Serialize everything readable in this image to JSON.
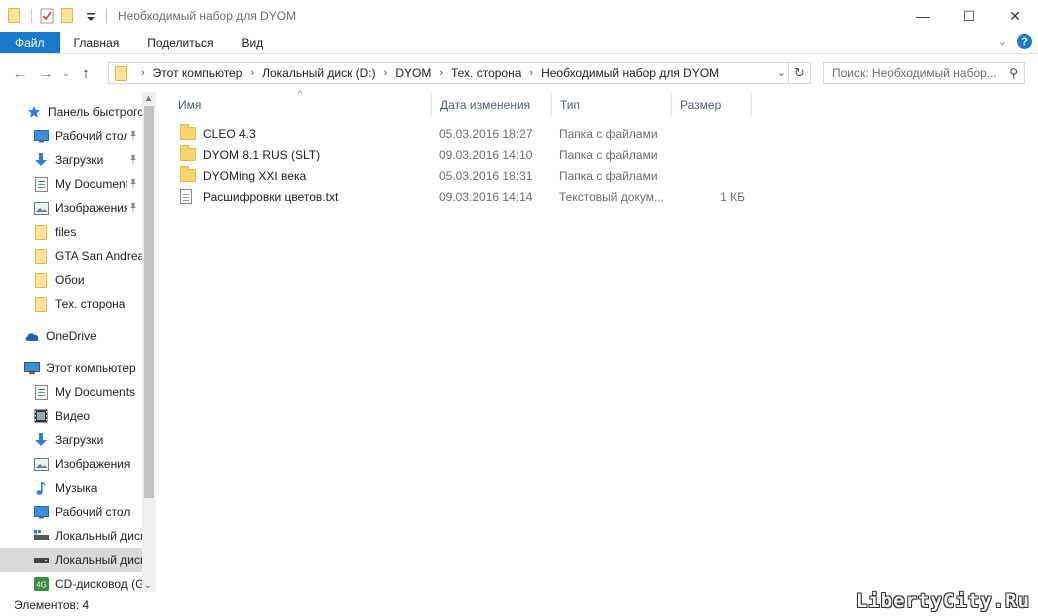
{
  "window": {
    "title": "Необходимый набор для DYOM",
    "minimize_glyph": "—",
    "maximize_glyph": "☐",
    "close_glyph": "✕"
  },
  "ribbon": {
    "tabs": [
      "Файл",
      "Главная",
      "Поделиться",
      "Вид"
    ],
    "accent_color": "#1979ca",
    "help_glyph": "?",
    "expand_glyph": "⌄"
  },
  "nav_buttons": {
    "back_glyph": "←",
    "forward_glyph": "→",
    "recent_glyph": "⌄",
    "up_glyph": "↑"
  },
  "address": {
    "breadcrumbs": [
      "Этот компьютер",
      "Локальный диск (D:)",
      "DYOM",
      "Тех. сторона",
      "Необходимый набор для DYOM"
    ],
    "separator_glyph": "›",
    "dropdown_glyph": "⌄",
    "refresh_glyph": "↻"
  },
  "search": {
    "placeholder": "Поиск: Необходимый набор...",
    "icon": "search-icon",
    "glyph": "⚲"
  },
  "navigation": {
    "items": [
      {
        "label": "Панель быстрого доступа",
        "icon": "star-icon",
        "pinned": false,
        "selected": false
      },
      {
        "label": "Рабочий стол",
        "icon": "desktop-icon",
        "pinned": true,
        "selected": false
      },
      {
        "label": "Загрузки",
        "icon": "download-icon",
        "pinned": true,
        "selected": false
      },
      {
        "label": "My Documents",
        "icon": "documents-icon",
        "pinned": true,
        "selected": false
      },
      {
        "label": "Изображения",
        "icon": "pictures-icon",
        "pinned": true,
        "selected": false
      },
      {
        "label": "files",
        "icon": "folder-icon",
        "pinned": false,
        "selected": false
      },
      {
        "label": "GTA San Andreas",
        "icon": "folder-icon",
        "pinned": false,
        "selected": false
      },
      {
        "label": "Обои",
        "icon": "folder-icon",
        "pinned": false,
        "selected": false
      },
      {
        "label": "Тех. сторона",
        "icon": "folder-icon",
        "pinned": false,
        "selected": false
      },
      {
        "label": "OneDrive",
        "icon": "cloud-icon",
        "pinned": false,
        "selected": false
      },
      {
        "label": "Этот компьютер",
        "icon": "computer-icon",
        "pinned": false,
        "selected": false
      },
      {
        "label": "My Documents",
        "icon": "documents-icon",
        "pinned": false,
        "selected": false
      },
      {
        "label": "Видео",
        "icon": "video-icon",
        "pinned": false,
        "selected": false
      },
      {
        "label": "Загрузки",
        "icon": "download-icon",
        "pinned": false,
        "selected": false
      },
      {
        "label": "Изображения",
        "icon": "pictures-icon",
        "pinned": false,
        "selected": false
      },
      {
        "label": "Музыка",
        "icon": "music-icon",
        "pinned": false,
        "selected": false
      },
      {
        "label": "Рабочий стол",
        "icon": "desktop-icon",
        "pinned": false,
        "selected": false
      },
      {
        "label": "Локальный диск (C:)",
        "icon": "drive-icon",
        "pinned": false,
        "selected": false
      },
      {
        "label": "Локальный диск (D:)",
        "icon": "drive-icon",
        "pinned": false,
        "selected": true
      },
      {
        "label": "CD-дисковод (G:)",
        "icon": "cd-icon",
        "pinned": false,
        "selected": false
      }
    ],
    "pin_glyph": "📌",
    "scroll_up_glyph": "▲",
    "scroll_down_glyph": "⌄"
  },
  "file_list": {
    "columns": [
      "Имя",
      "Дата изменения",
      "Тип",
      "Размер"
    ],
    "sort_glyph": "^",
    "rows": [
      {
        "name": "CLEO 4.3",
        "date": "05.03.2016 18:27",
        "type": "Папка с файлами",
        "size": "",
        "icon": "folder-icon"
      },
      {
        "name": "DYOM 8.1 RUS (SLT)",
        "date": "09.03.2016 14:10",
        "type": "Папка с файлами",
        "size": "",
        "icon": "folder-icon"
      },
      {
        "name": "DYOMing XXI века",
        "date": "05.03.2016 18:31",
        "type": "Папка с файлами",
        "size": "",
        "icon": "folder-icon"
      },
      {
        "name": "Расшифровки цветов.txt",
        "date": "09.03.2016 14:14",
        "type": "Текстовый докум...",
        "size": "1 КБ",
        "icon": "text-file-icon"
      }
    ]
  },
  "status": {
    "text": "Элементов: 4"
  },
  "watermark": "LibertyCity.Ru"
}
